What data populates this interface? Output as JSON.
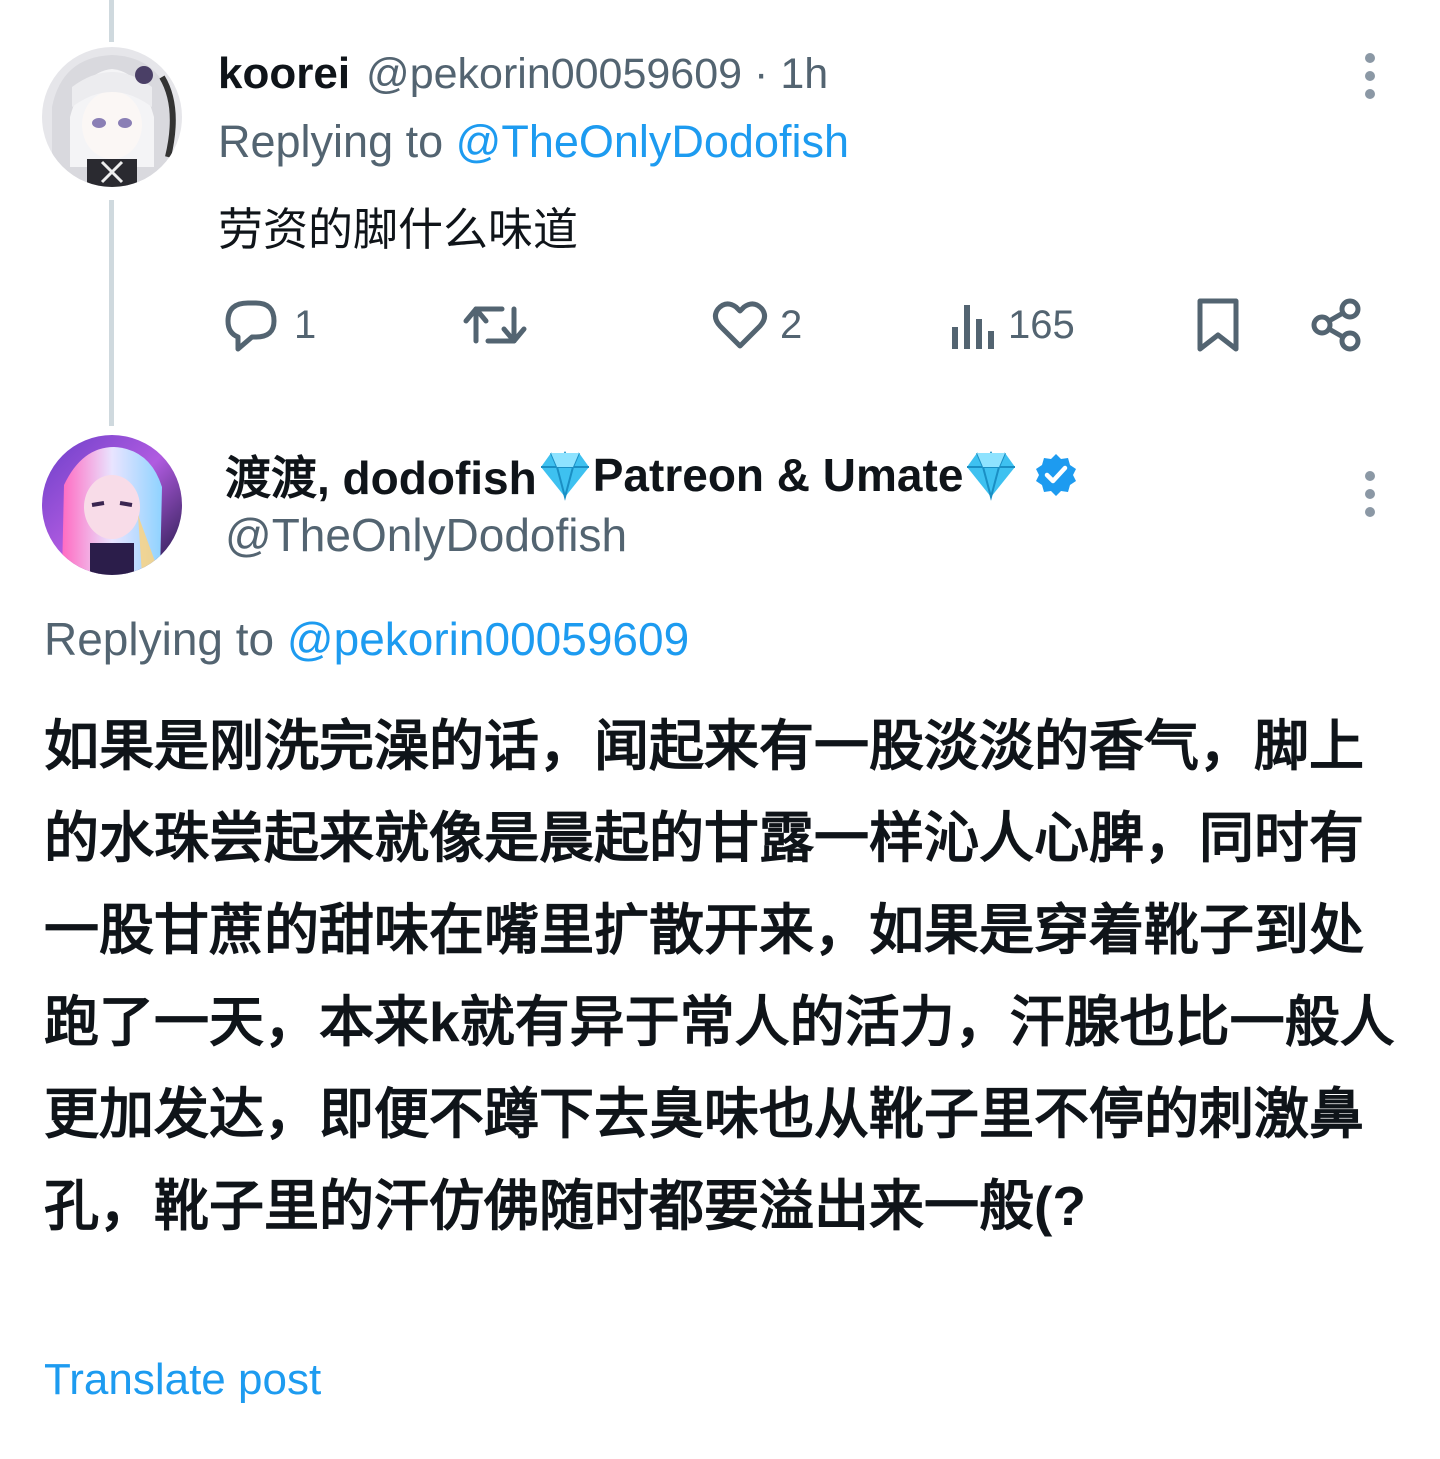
{
  "tweet1": {
    "author_name": "koorei",
    "handle": "@pekorin00059609",
    "separator": "·",
    "time": "1h",
    "replying_prefix": "Replying to",
    "replying_handle": "@TheOnlyDodofish",
    "text": "劳资的脚什么味道",
    "actions": {
      "replies": "1",
      "reposts": "",
      "likes": "2",
      "views": "165"
    }
  },
  "tweet2": {
    "author_name_part1": "渡渡, dodofish ",
    "author_name_part2": "Patreon & Umate",
    "handle": "@TheOnlyDodofish",
    "replying_prefix": "Replying to",
    "replying_handle": "@pekorin00059609",
    "text": "如果是刚洗完澡的话，闻起来有一股淡淡的香气，脚上的水珠尝起来就像是晨起的甘露一样沁人心脾，同时有一股甘蔗的甜味在嘴里扩散开来，如果是穿着靴子到处跑了一天，本来k就有异于常人的活力，汗腺也比一般人更加发达，即便不蹲下去臭味也从靴子里不停的刺激鼻孔，靴子里的汗仿佛随时都要溢出来一般(?",
    "translate_label": "Translate post"
  },
  "icons": {
    "reply": "reply-icon",
    "repost": "repost-icon",
    "like": "heart-icon",
    "views": "views-icon",
    "bookmark": "bookmark-icon",
    "share": "share-icon",
    "more": "more-icon",
    "verified": "verified-badge-icon",
    "gem": "gem-icon"
  },
  "colors": {
    "link": "#1d9bf0",
    "muted": "#536471",
    "text": "#0f1419",
    "thread_line": "#cfd9de",
    "gem": "#3ec1f0"
  }
}
